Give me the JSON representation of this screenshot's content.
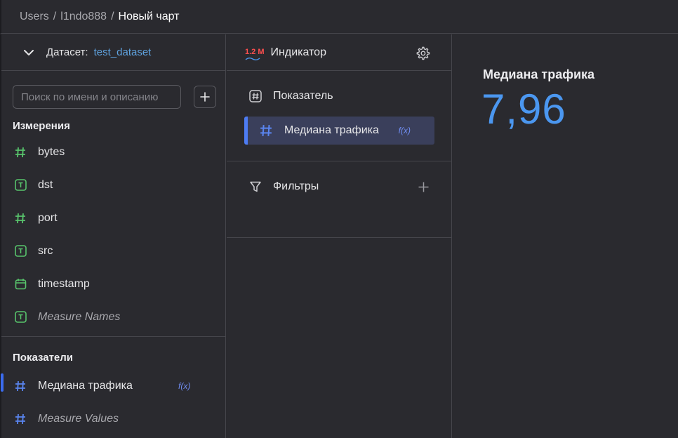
{
  "breadcrumb": {
    "root": "Users",
    "user": "l1ndo888",
    "current": "Новый чарт",
    "separator": "/"
  },
  "dataset": {
    "label": "Датасет:",
    "name": "test_dataset"
  },
  "search": {
    "placeholder": "Поиск по имени и описанию"
  },
  "dimensions": {
    "title": "Измерения",
    "items": [
      {
        "label": "bytes",
        "type": "number"
      },
      {
        "label": "dst",
        "type": "text"
      },
      {
        "label": "port",
        "type": "number"
      },
      {
        "label": "src",
        "type": "text"
      },
      {
        "label": "timestamp",
        "type": "date"
      },
      {
        "label": "Measure Names",
        "type": "text"
      }
    ]
  },
  "measures": {
    "title": "Показатели",
    "items": [
      {
        "label": "Медиана трафика",
        "fx": "f(x)"
      },
      {
        "label": "Measure Values"
      }
    ]
  },
  "visualization": {
    "logo": "1.2 M",
    "label": "Индикатор",
    "section_measure": "Показатель",
    "measure_chip": "Медиана трафика",
    "measure_chip_fx": "f(x)",
    "filters_label": "Фильтры"
  },
  "indicator": {
    "title": "Медиана трафика",
    "value": "7,96"
  },
  "colors": {
    "accent": "#4b97f0",
    "dim_icon": "#58c46c",
    "measure_icon": "#5a85f0",
    "background": "#2a2a2f"
  }
}
